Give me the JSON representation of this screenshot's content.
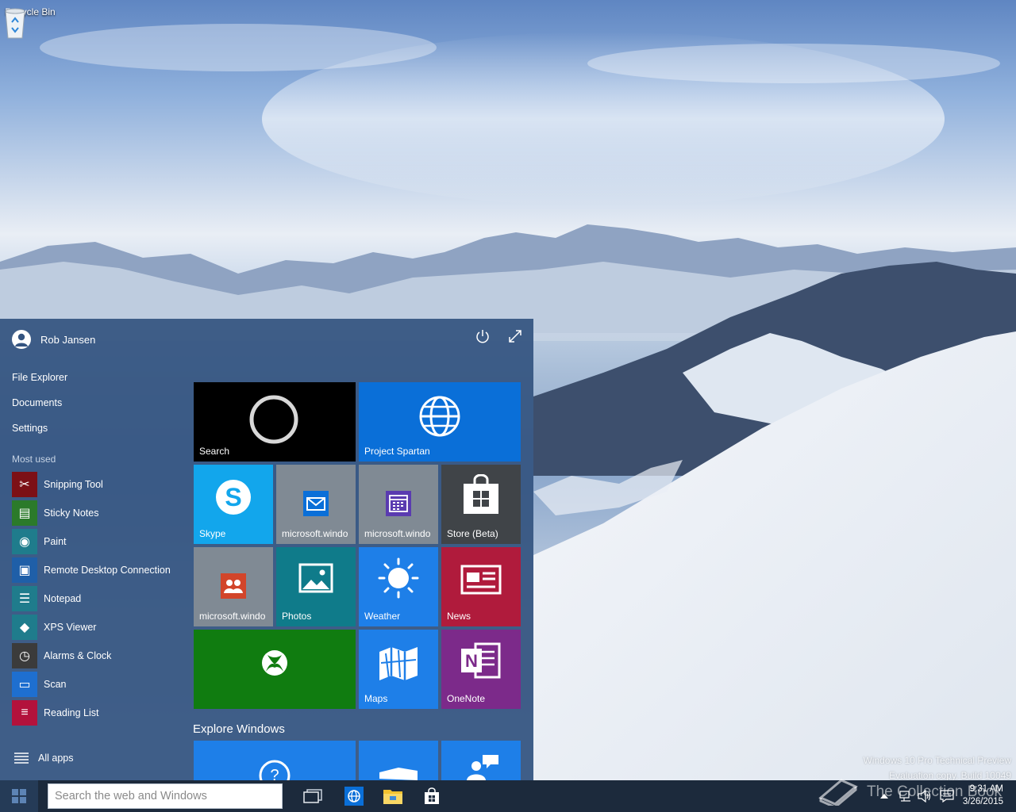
{
  "desktop": {
    "recycle_bin": "Recycle Bin",
    "watermark_line1": "Windows 10 Pro Technical Preview",
    "watermark_line2": "Evaluation copy. Build 10049",
    "overlay_text": "The Collection Book"
  },
  "start": {
    "user_name": "Rob Jansen",
    "places": [
      "File Explorer",
      "Documents",
      "Settings"
    ],
    "most_used_label": "Most used",
    "apps": [
      {
        "label": "Snipping Tool",
        "icon": "scissors-icon",
        "color": "#7c1016"
      },
      {
        "label": "Sticky Notes",
        "icon": "sticky-note-icon",
        "color": "#2b7a2a"
      },
      {
        "label": "Paint",
        "icon": "palette-icon",
        "color": "#1f7c8c"
      },
      {
        "label": "Remote Desktop Connection",
        "icon": "remote-desktop-icon",
        "color": "#1f5fa8"
      },
      {
        "label": "Notepad",
        "icon": "notepad-icon",
        "color": "#1f7c8c"
      },
      {
        "label": "XPS Viewer",
        "icon": "xps-icon",
        "color": "#1f7c8c"
      },
      {
        "label": "Alarms & Clock",
        "icon": "alarm-clock-icon",
        "color": "#3b3b3b"
      },
      {
        "label": "Scan",
        "icon": "scanner-icon",
        "color": "#1e6fd0"
      },
      {
        "label": "Reading List",
        "icon": "reading-list-icon",
        "color": "#b3123c"
      }
    ],
    "all_apps": "All apps",
    "explore_label": "Explore Windows",
    "tiles": {
      "search": "Search",
      "spartan": "Project Spartan",
      "skype": "Skype",
      "mail": "microsoft.windo",
      "calendar": "microsoft.windo",
      "store": "Store (Beta)",
      "people": "microsoft.windo",
      "photos": "Photos",
      "weather": "Weather",
      "news": "News",
      "xbox": "",
      "maps": "Maps",
      "onenote": "OneNote"
    }
  },
  "taskbar": {
    "search_placeholder": "Search the web and Windows",
    "time": "9:31 AM",
    "date": "3/26/2015"
  },
  "colors": {
    "start_bg": "#345480",
    "taskbar_bg": "#1c2a3c",
    "tile_blue": "#0a6fd8",
    "tile_gray": "#808a94",
    "tile_teal": "#0f7b8a",
    "tile_red": "#b01b3c",
    "tile_green": "#107c10",
    "tile_purple": "#7c2a8a",
    "skype": "#12a6ec"
  }
}
